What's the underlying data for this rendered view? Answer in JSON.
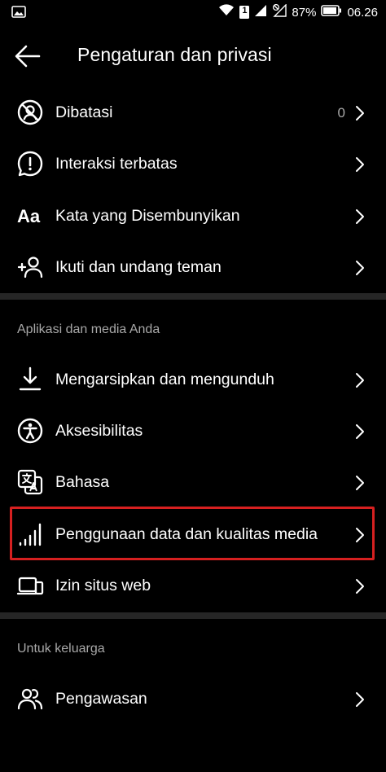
{
  "status_bar": {
    "battery_percent": "87%",
    "time": "06.26",
    "notification_badge": "1"
  },
  "header": {
    "title": "Pengaturan dan privasi"
  },
  "section_privacy": {
    "items": [
      {
        "label": "Dibatasi",
        "count": "0",
        "icon": "restricted-icon"
      },
      {
        "label": "Interaksi terbatas",
        "icon": "limited-interactions-icon"
      },
      {
        "label": "Kata yang Disembunyikan",
        "icon": "hidden-words-icon"
      },
      {
        "label": "Ikuti dan undang teman",
        "icon": "add-person-icon"
      }
    ]
  },
  "section_apps": {
    "title": "Aplikasi dan media Anda",
    "items": [
      {
        "label": "Mengarsipkan dan mengunduh",
        "icon": "download-icon"
      },
      {
        "label": "Aksesibilitas",
        "icon": "accessibility-icon"
      },
      {
        "label": "Bahasa",
        "icon": "translate-icon"
      },
      {
        "label": "Penggunaan data dan kualitas media",
        "icon": "signal-bars-icon",
        "highlighted": true
      },
      {
        "label": "Izin situs web",
        "icon": "devices-icon"
      }
    ]
  },
  "section_family": {
    "title": "Untuk keluarga",
    "items": [
      {
        "label": "Pengawasan",
        "icon": "supervision-icon"
      }
    ]
  },
  "colors": {
    "background": "#000000",
    "divider": "#262626",
    "secondary_text": "#a8a8a8",
    "highlight_border": "#d62020"
  }
}
